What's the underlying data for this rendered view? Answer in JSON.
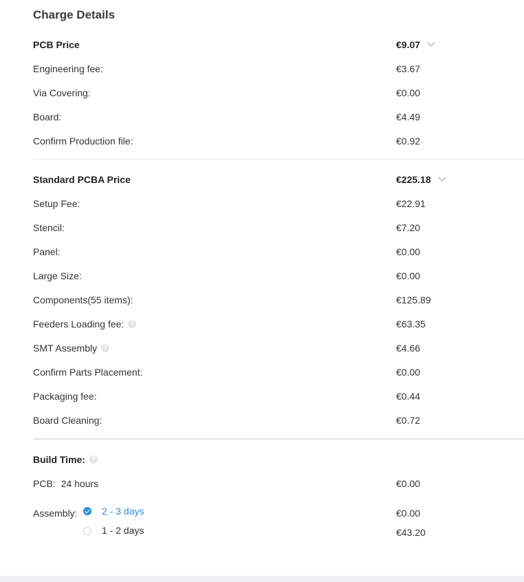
{
  "title": "Charge Details",
  "pcb": {
    "header_label": "PCB Price",
    "header_value": "€9.07",
    "items": [
      {
        "label": "Engineering fee:",
        "value": "€3.67"
      },
      {
        "label": "Via Covering:",
        "value": "€0.00"
      },
      {
        "label": "Board:",
        "value": "€4.49"
      },
      {
        "label": "Confirm Production file:",
        "value": "€0.92"
      }
    ]
  },
  "pcba": {
    "header_label": "Standard PCBA Price",
    "header_value": "€225.18",
    "items": [
      {
        "label": "Setup Fee:",
        "value": "€22.91"
      },
      {
        "label": "Stencil:",
        "value": "€7.20"
      },
      {
        "label": "Panel:",
        "value": "€0.00"
      },
      {
        "label": "Large Size:",
        "value": "€0.00"
      },
      {
        "label": "Components(55 items):",
        "value": "€125.89"
      },
      {
        "label": "Feeders Loading fee:",
        "value": "€63.35"
      },
      {
        "label": "SMT Assembly",
        "value": "€4.66"
      },
      {
        "label": "Confirm Parts Placement:",
        "value": "€0.00"
      },
      {
        "label": "Packaging fee:",
        "value": "€0.44"
      },
      {
        "label": "Board Cleaning:",
        "value": "€0.72"
      }
    ]
  },
  "build_time": {
    "label": "Build Time:",
    "pcb_label": "PCB:",
    "pcb_time": "24 hours",
    "pcb_value": "€0.00",
    "assembly_label": "Assembly:",
    "options": [
      {
        "label": "2 - 3 days",
        "value": "€0.00",
        "selected": true
      },
      {
        "label": "1 - 2 days",
        "value": "€43.20",
        "selected": false
      }
    ]
  },
  "icons": {
    "help": "question-circle-icon",
    "chevron": "chevron-down-icon"
  },
  "colors": {
    "accent": "#2e8ce6",
    "divider": "#e8e8e8",
    "footer_bar": "#eef0f3"
  }
}
